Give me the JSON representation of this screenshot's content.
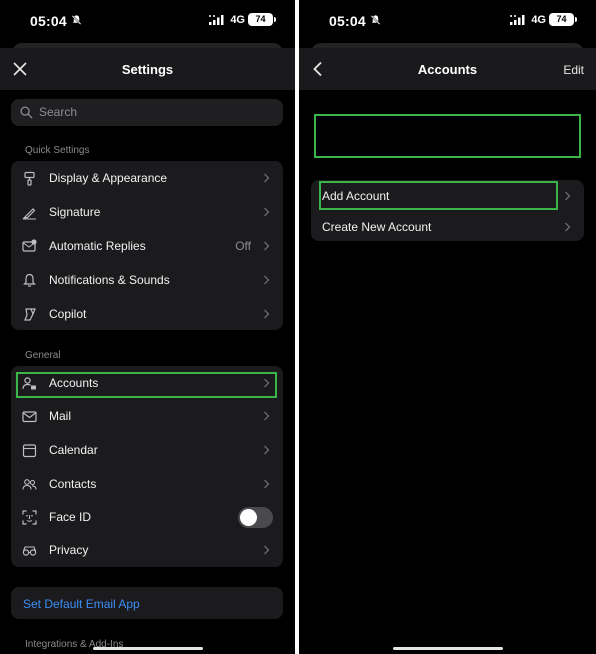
{
  "left": {
    "status": {
      "time": "05:04",
      "network": "4G",
      "battery": "74"
    },
    "header": {
      "title": "Settings"
    },
    "search": {
      "placeholder": "Search"
    },
    "quick_settings": {
      "label": "Quick Settings",
      "items": [
        {
          "label": "Display & Appearance",
          "icon": "paint-roller-icon"
        },
        {
          "label": "Signature",
          "icon": "signature-icon"
        },
        {
          "label": "Automatic Replies",
          "icon": "auto-reply-icon",
          "value": "Off"
        },
        {
          "label": "Notifications & Sounds",
          "icon": "bell-icon"
        },
        {
          "label": "Copilot",
          "icon": "copilot-icon"
        }
      ]
    },
    "general": {
      "label": "General",
      "items": [
        {
          "label": "Accounts",
          "icon": "accounts-icon"
        },
        {
          "label": "Mail",
          "icon": "mail-icon"
        },
        {
          "label": "Calendar",
          "icon": "calendar-icon"
        },
        {
          "label": "Contacts",
          "icon": "contacts-icon"
        },
        {
          "label": "Face ID",
          "icon": "face-id-icon",
          "toggle": false
        },
        {
          "label": "Privacy",
          "icon": "privacy-icon"
        }
      ]
    },
    "set_default": {
      "label": "Set Default Email App"
    },
    "integrations": {
      "label": "Integrations & Add-Ins"
    }
  },
  "right": {
    "status": {
      "time": "05:04",
      "network": "4G",
      "battery": "74"
    },
    "header": {
      "title": "Accounts",
      "edit_label": "Edit"
    },
    "accounts": [
      {
        "label": "Add Account"
      },
      {
        "label": "Create New Account"
      }
    ]
  },
  "colors": {
    "highlight": "#3bb54a",
    "link": "#3d8ef7",
    "background": "#000000"
  }
}
